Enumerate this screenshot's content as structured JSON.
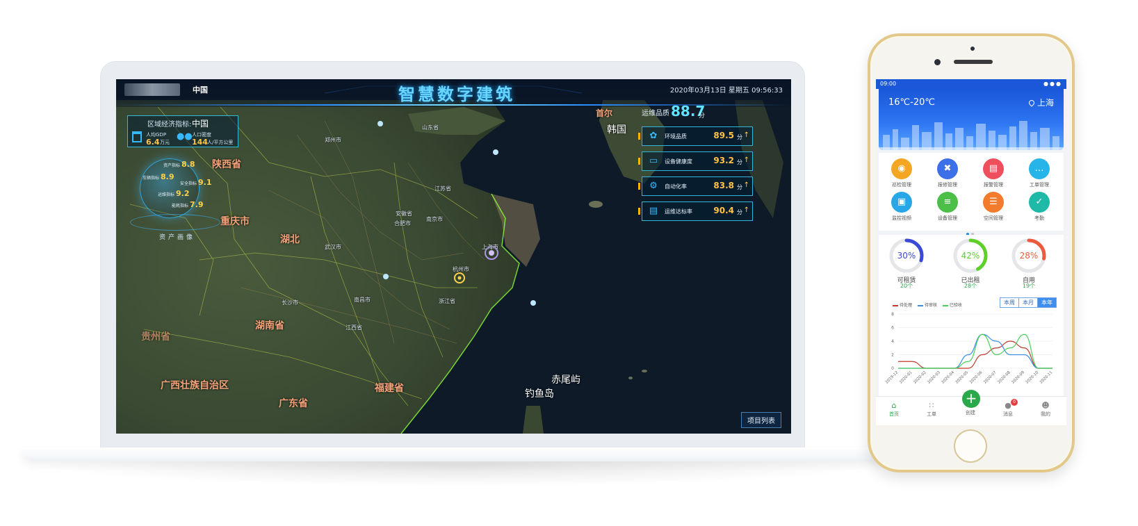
{
  "dashboard": {
    "title": "智慧数字建筑",
    "region": "中国",
    "datetime": "2020年03月13日 星期五 09:56:33",
    "economy": {
      "label": "区域经济指标:",
      "region": "中国",
      "gdp_label": "人均GDP",
      "gdp_value": "6.4",
      "gdp_unit": "万元",
      "population_label": "人口密度",
      "population_value": "144",
      "population_unit": "人/平方公里"
    },
    "assets": {
      "label": "资产画像",
      "stats": [
        {
          "key": "资产指标",
          "value": "8.8"
        },
        {
          "key": "车辆指标",
          "value": "8.9"
        },
        {
          "key": "安全指标",
          "value": "9.1"
        },
        {
          "key": "运维指标",
          "value": "9.2"
        },
        {
          "key": "能耗指标",
          "value": "7.9"
        }
      ]
    },
    "quality": {
      "label": "运维品质",
      "score": "88.7",
      "unit": "分"
    },
    "metrics": [
      {
        "label": "环境品质",
        "value": "89.5",
        "unit": "分",
        "icon": "leaf-icon"
      },
      {
        "label": "设备健康度",
        "value": "93.2",
        "unit": "分",
        "icon": "device-icon"
      },
      {
        "label": "自动化率",
        "value": "83.8",
        "unit": "分",
        "icon": "gears-icon"
      },
      {
        "label": "运维达标率",
        "value": "90.4",
        "unit": "分",
        "icon": "chart-up-icon"
      }
    ],
    "project_list_button": "项目列表",
    "map_labels": {
      "provinces": [
        "陕西省",
        "重庆市",
        "湖北",
        "湖南省",
        "贵州省",
        "广西壮族自治区",
        "广东省",
        "福建省"
      ],
      "korea": "韩国",
      "korea_capital": "首尔",
      "islands": [
        "赤尾屿",
        "钓鱼岛"
      ],
      "cities": [
        "郑州市",
        "山东省",
        "江苏省",
        "安徽省",
        "合肥市",
        "南京市",
        "武汉市",
        "杭州市",
        "上海市",
        "南昌市",
        "浙江省",
        "长沙市",
        "江西省"
      ]
    }
  },
  "phone": {
    "status_time": "09:00",
    "weather": {
      "temperature": "16℃-20℃",
      "city": "上海"
    },
    "apps": [
      {
        "label": "巡检管理",
        "color": "#f4a623",
        "icon": "location-icon"
      },
      {
        "label": "报修管理",
        "color": "#3c6fe8",
        "icon": "tools-icon"
      },
      {
        "label": "报警管理",
        "color": "#ef4e5c",
        "icon": "document-icon"
      },
      {
        "label": "工单管理",
        "color": "#27b4e8",
        "icon": "chat-icon"
      },
      {
        "label": "监控视频",
        "color": "#27a7e8",
        "icon": "briefcase-icon"
      },
      {
        "label": "设备管理",
        "color": "#4cbf48",
        "icon": "list-icon"
      },
      {
        "label": "空间管理",
        "color": "#f37b2c",
        "icon": "layers-icon"
      },
      {
        "label": "考勤",
        "color": "#1fb9a8",
        "icon": "clipboard-icon"
      }
    ],
    "rings": [
      {
        "percent": 30,
        "text": "30%",
        "label": "可租赁",
        "count": "20个",
        "color": "#3a49d6"
      },
      {
        "percent": 42,
        "text": "42%",
        "label": "已出租",
        "count": "28个",
        "color": "#5fcf2a"
      },
      {
        "percent": 28,
        "text": "28%",
        "label": "自用",
        "count": "19个",
        "color": "#ee5a3c"
      }
    ],
    "periods": [
      "本周",
      "本月",
      "本年"
    ],
    "active_period": "本年",
    "tabs": {
      "home": "首页",
      "work_orders": "工单",
      "create": "创建",
      "messages": "消息",
      "mine": "我的",
      "message_badge": "0"
    }
  },
  "chart_data": {
    "type": "line",
    "x": [
      "2019-12",
      "2020-01",
      "2020-02",
      "2020-03",
      "2020-04",
      "2020-05",
      "2020-06",
      "2020-07",
      "2020-08",
      "2020-09",
      "2020-10",
      "2020-11"
    ],
    "ylim": [
      0,
      8
    ],
    "yticks": [
      0,
      2,
      4,
      6,
      8
    ],
    "series": [
      {
        "name": "待处理",
        "color": "#c0392b",
        "values": [
          1,
          1,
          0,
          0,
          0,
          0,
          2,
          3,
          4,
          3,
          0,
          0
        ]
      },
      {
        "name": "待审核",
        "color": "#3b8ee8",
        "values": [
          0,
          0,
          0,
          0,
          0,
          2,
          5,
          4,
          2,
          2,
          0,
          0
        ]
      },
      {
        "name": "已验收",
        "color": "#4ccf5a",
        "values": [
          0,
          0,
          0,
          0,
          0,
          1,
          5,
          2,
          3,
          5,
          0,
          0
        ]
      }
    ]
  }
}
